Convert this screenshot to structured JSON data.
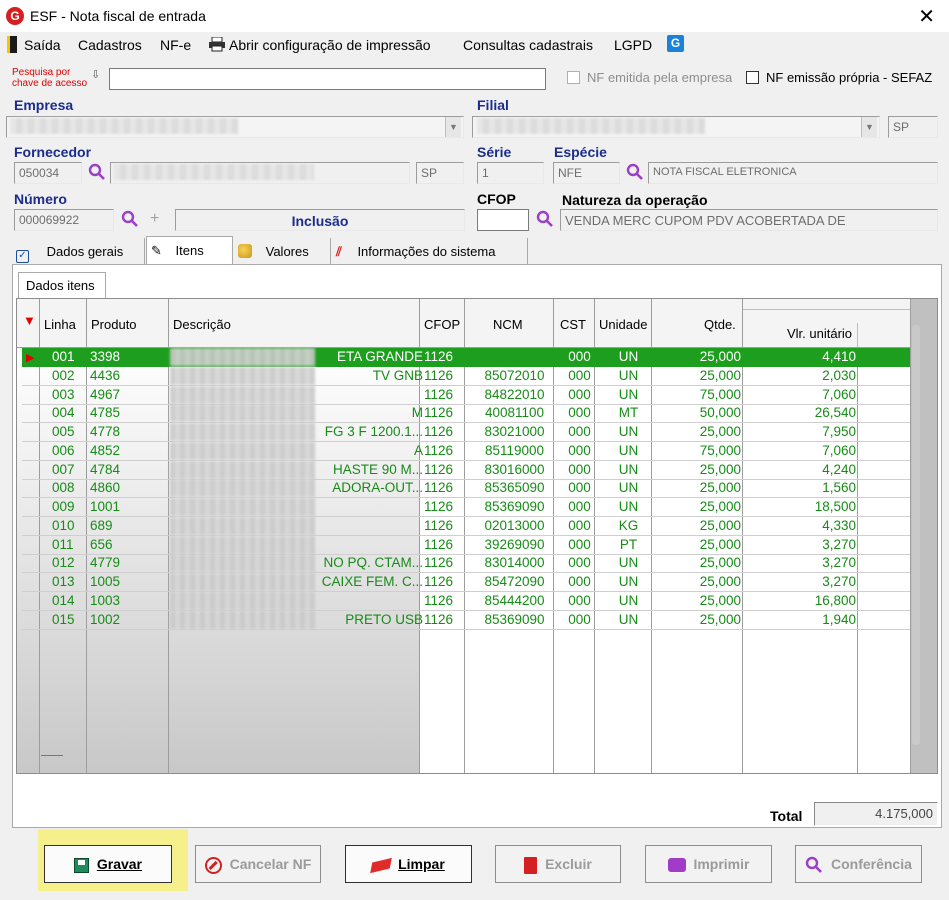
{
  "window": {
    "title": "ESF - Nota fiscal de entrada",
    "logo_letter": "G"
  },
  "menu": {
    "items": [
      "Saída",
      "Cadastros",
      "NF-e",
      "Abrir configuração de impressão",
      "Consultas cadastrais",
      "LGPD"
    ],
    "g_icon_letter": "G"
  },
  "search": {
    "label_line1": "Pesquisa por",
    "label_line2": "chave de acesso",
    "value": "",
    "cb_emitida_label": "NF emitida pela empresa",
    "cb_propria_label": "NF emissão própria - SEFAZ"
  },
  "labels": {
    "empresa": "Empresa",
    "filial": "Filial",
    "fornecedor": "Fornecedor",
    "serie": "Série",
    "especie": "Espécie",
    "numero": "Número",
    "cfop": "CFOP",
    "natureza": "Natureza da operação"
  },
  "values": {
    "filial_uf": "SP",
    "fornecedor_codigo": "050034",
    "fornecedor_uf": "SP",
    "serie": "1",
    "especie": "NFE",
    "especie_desc": "NOTA FISCAL ELETRONICA",
    "numero": "000069922",
    "modo": "Inclusão",
    "cfop": "",
    "natureza": "VENDA MERC CUPOM PDV ACOBERTADA DE"
  },
  "tabs": [
    "Dados gerais",
    "Itens",
    "Valores",
    "Informações do sistema"
  ],
  "subtab": "Dados itens",
  "grid": {
    "headers": [
      "Linha",
      "Produto",
      "Descrição",
      "CFOP",
      "NCM",
      "CST",
      "Unidade",
      "Qtde.",
      "Vlr. unitário"
    ],
    "rows": [
      {
        "linha": "001",
        "produto": "3398",
        "desc": "ETA GRANDE",
        "cfop": "1126",
        "ncm": "",
        "cst": "000",
        "un": "UN",
        "qtde": "25,000",
        "vlr": "4,410"
      },
      {
        "linha": "002",
        "produto": "4436",
        "desc": "TV GNB",
        "cfop": "1126",
        "ncm": "85072010",
        "cst": "000",
        "un": "UN",
        "qtde": "25,000",
        "vlr": "2,030"
      },
      {
        "linha": "003",
        "produto": "4967",
        "desc": "",
        "cfop": "1126",
        "ncm": "84822010",
        "cst": "000",
        "un": "UN",
        "qtde": "75,000",
        "vlr": "7,060"
      },
      {
        "linha": "004",
        "produto": "4785",
        "desc": "M",
        "cfop": "1126",
        "ncm": "40081100",
        "cst": "000",
        "un": "MT",
        "qtde": "50,000",
        "vlr": "26,540"
      },
      {
        "linha": "005",
        "produto": "4778",
        "desc": "FG 3 F 1200.1...",
        "cfop": "1126",
        "ncm": "83021000",
        "cst": "000",
        "un": "UN",
        "qtde": "25,000",
        "vlr": "7,950"
      },
      {
        "linha": "006",
        "produto": "4852",
        "desc": "A",
        "cfop": "1126",
        "ncm": "85119000",
        "cst": "000",
        "un": "UN",
        "qtde": "75,000",
        "vlr": "7,060"
      },
      {
        "linha": "007",
        "produto": "4784",
        "desc": "HASTE 90 M...",
        "cfop": "1126",
        "ncm": "83016000",
        "cst": "000",
        "un": "UN",
        "qtde": "25,000",
        "vlr": "4,240"
      },
      {
        "linha": "008",
        "produto": "4860",
        "desc": "ADORA-OUT...",
        "cfop": "1126",
        "ncm": "85365090",
        "cst": "000",
        "un": "UN",
        "qtde": "25,000",
        "vlr": "1,560"
      },
      {
        "linha": "009",
        "produto": "1001",
        "desc": "",
        "cfop": "1126",
        "ncm": "85369090",
        "cst": "000",
        "un": "UN",
        "qtde": "25,000",
        "vlr": "18,500"
      },
      {
        "linha": "010",
        "produto": "689",
        "desc": "",
        "cfop": "1126",
        "ncm": "02013000",
        "cst": "000",
        "un": "KG",
        "qtde": "25,000",
        "vlr": "4,330"
      },
      {
        "linha": "011",
        "produto": "656",
        "desc": "",
        "cfop": "1126",
        "ncm": "39269090",
        "cst": "000",
        "un": "PT",
        "qtde": "25,000",
        "vlr": "3,270"
      },
      {
        "linha": "012",
        "produto": "4779",
        "desc": "NO PQ. CTAM...",
        "cfop": "1126",
        "ncm": "83014000",
        "cst": "000",
        "un": "UN",
        "qtde": "25,000",
        "vlr": "3,270"
      },
      {
        "linha": "013",
        "produto": "1005",
        "desc": "CAIXE FEM. C...",
        "cfop": "1126",
        "ncm": "85472090",
        "cst": "000",
        "un": "UN",
        "qtde": "25,000",
        "vlr": "3,270"
      },
      {
        "linha": "014",
        "produto": "1003",
        "desc": "",
        "cfop": "1126",
        "ncm": "85444200",
        "cst": "000",
        "un": "UN",
        "qtde": "25,000",
        "vlr": "16,800"
      },
      {
        "linha": "015",
        "produto": "1002",
        "desc": "PRETO USB",
        "cfop": "1126",
        "ncm": "85369090",
        "cst": "000",
        "un": "UN",
        "qtde": "25,000",
        "vlr": "1,940"
      }
    ]
  },
  "total": {
    "label": "Total",
    "value": "4.175,000"
  },
  "buttons": {
    "gravar": "Gravar",
    "cancelar": "Cancelar NF",
    "limpar": "Limpar",
    "excluir": "Excluir",
    "imprimir": "Imprimir",
    "conferencia": "Conferência"
  },
  "colors": {
    "row_text": "#178b17",
    "row_selected": "#1e9e1e",
    "label_blue": "#1c2c8c",
    "highlight": "#f5f08c"
  }
}
